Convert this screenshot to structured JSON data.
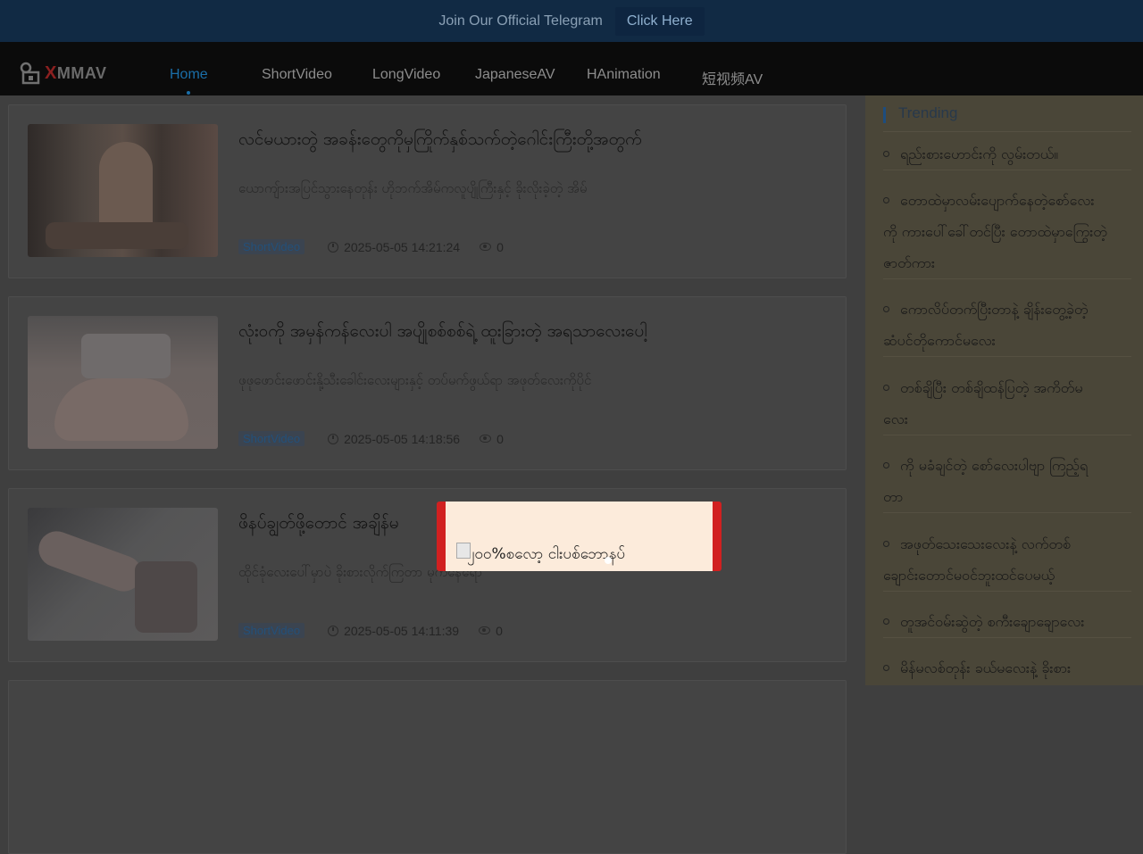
{
  "topbar": {
    "text": "Join Our Official Telegram",
    "button": "Click Here"
  },
  "logo": {
    "text": "MMAV",
    "x_letter": "X"
  },
  "nav": [
    "Home",
    "ShortVideo",
    "LongVideo",
    "JapaneseAV",
    "HAnimation",
    "短视频AV"
  ],
  "cards": [
    {
      "title": "လင်မယားတွဲ အခန်းတွေကိုမှကြိုက်နှစ်သက်တဲ့ဂေါင်းကြီးတို့အတွက်",
      "desc": "ယောကျ်ားအပြင်သွားနေတုန်း ဟိုဘက်အိမ်ကလူပျိုကြီးနှင့် ခိုးလိုးခဲ့တဲ့ အိမ်",
      "tag": "ShortVideo",
      "time": "2025-05-05 14:21:24",
      "views": "0"
    },
    {
      "title": "လုံးဝကို အမှန်ကန်လေးပါ အပျိုစစ်စစ်ရဲ့ ထူးခြားတဲ့ အရသာလေးပေါ့",
      "desc": "ဖုဖုဖောင်းဖောင်းနို့သီးခေါင်းလေးများနှင့် တပ်မက်ဖွယ်ရာ အဖုတ်လေးကိုပိုင်",
      "tag": "ShortVideo",
      "time": "2025-05-05 14:18:56",
      "views": "0"
    },
    {
      "title": "ဖိနပ်ချွတ်ဖို့တောင် အချိန်မ",
      "desc": "ထိုင်ခုံလေးပေါ်မှာပဲ ခိုးစားလိုက်ကြတာ မုကနေရော",
      "tag": "ShortVideo",
      "time": "2025-05-05 14:11:39",
      "views": "0"
    }
  ],
  "sidebar": {
    "title": "Trending",
    "items": [
      [
        "ရည်းစားဟောင်းကို လွမ်းတယ်။"
      ],
      [
        "တောထဲမှာလမ်းပျောက်နေတဲ့စော်လေး",
        "ကို ကားပေါ်ခေါ်တင်ပြီး တောထဲမှာကြွေးတဲ့",
        "ဇာတ်ကား"
      ],
      [
        "ကောလိပ်တက်ပြီးတာနဲ့ ချိန်းတွေ့ခဲ့တဲ့",
        "ဆံပင်တိုကောင်မလေး"
      ],
      [
        "တစ်ချိပြီး တစ်ချိထန်ပြတဲ့ အကိတ်မ",
        "လေး"
      ],
      [
        "ကို မခံချင်တဲ့ စော်လေးပါဗျာ ကြည့်ရ",
        "တာ"
      ],
      [
        "အဖုတ်သေးသေးလေးနဲ့ လက်တစ်",
        "ချောင်းတောင်မဝင်ဘူးထင်ပေမယ့်"
      ],
      [
        "တူအင်ဝမ်းဆွဲတဲ့ စကီးချောချောလေး"
      ],
      [
        "မိန်မလစ်တုန်း ခယ်မလေးနဲ့ ခိုးစား"
      ]
    ]
  },
  "popup": {
    "alt": "၂၀၀%စလော့ ငါးပစ်ဘောနပ်"
  }
}
